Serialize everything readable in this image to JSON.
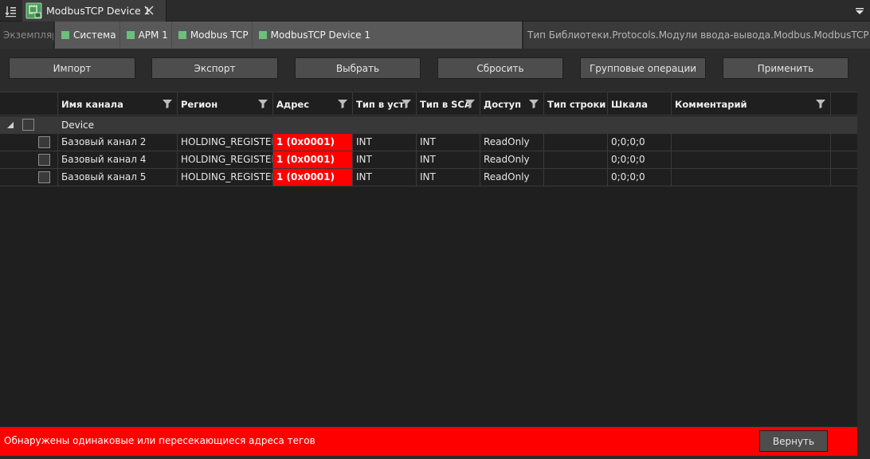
{
  "tab": {
    "title": "ModbusTCP Device 1",
    "icons": {
      "left": "list-sort-icon",
      "device": "device-module-icon",
      "close": "close-icon",
      "right": "dropdown-menu-icon"
    }
  },
  "breadcrumb": {
    "instance_label": "Экземпляр",
    "items": [
      {
        "label": "Система"
      },
      {
        "label": "АРМ 1"
      },
      {
        "label": "Modbus TCP"
      },
      {
        "label": "ModbusTCP Device 1"
      }
    ],
    "type_label": "Тип Библиотеки.Protocols.Модули ввода-вывода.Modbus.ModbusTCP Device",
    "marker_color": "#6cc07a"
  },
  "toolbar": {
    "import_label": "Импорт",
    "export_label": "Экспорт",
    "select_label": "Выбрать",
    "reset_label": "Сбросить",
    "group_ops_label": "Групповые операции",
    "apply_label": "Применить"
  },
  "grid": {
    "columns": [
      {
        "label": "Имя канала"
      },
      {
        "label": "Регион"
      },
      {
        "label": "Адрес"
      },
      {
        "label": "Тип в уст"
      },
      {
        "label": "Тип в SCA"
      },
      {
        "label": "Доступ"
      },
      {
        "label": "Тип строки"
      },
      {
        "label": "Шкала"
      },
      {
        "label": "Комментарий"
      }
    ],
    "group": {
      "label": "Device"
    },
    "rows": [
      {
        "name": "Базовый канал 2",
        "region": "HOLDING_REGISTERS",
        "address": "1 (0x0001)",
        "type_device": "INT",
        "type_scada": "INT",
        "access": "ReadOnly",
        "string_type": "",
        "scale": "0;0;0;0",
        "comment": ""
      },
      {
        "name": "Базовый канал 4",
        "region": "HOLDING_REGISTERS",
        "address": "1 (0x0001)",
        "type_device": "INT",
        "type_scada": "INT",
        "access": "ReadOnly",
        "string_type": "",
        "scale": "0;0;0;0",
        "comment": ""
      },
      {
        "name": "Базовый канал 5",
        "region": "HOLDING_REGISTERS",
        "address": "1 (0x0001)",
        "type_device": "INT",
        "type_scada": "INT",
        "access": "ReadOnly",
        "string_type": "",
        "scale": "0;0;0;0",
        "comment": ""
      }
    ],
    "error_color": "#ff0000"
  },
  "status": {
    "message": "Обнаружены одинаковые или пересекающиеся адреса тегов",
    "revert_label": "Вернуть"
  }
}
